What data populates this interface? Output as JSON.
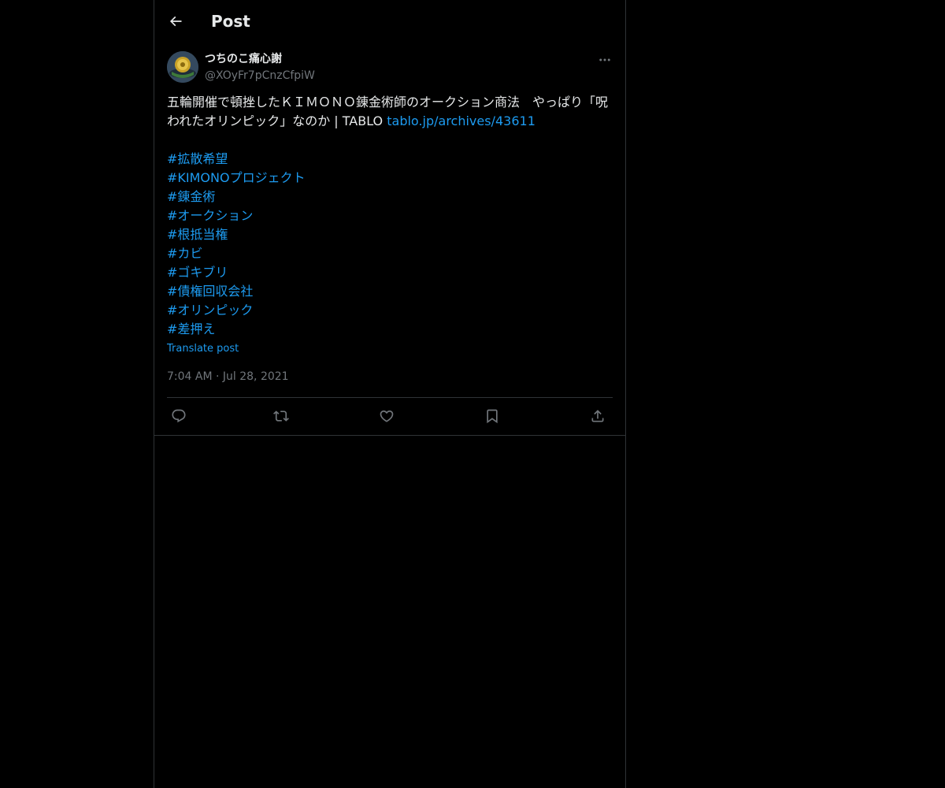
{
  "header": {
    "title": "Post",
    "back_icon": "arrow-left-icon"
  },
  "post": {
    "author": {
      "display_name": "つちのこ痛心謝",
      "handle": "@XOyFr7pCnzCfpiW",
      "avatar_icon": "police-emblem-avatar"
    },
    "more_icon": "more-horizontal-icon",
    "text_line": "五輪開催で頓挫したＫＩＭＯＮＯ錬金術師のオークション商法　やっぱり「呪われたオリンピック」なのか | TABLO ",
    "link_text": "tablo.jp/archives/43611",
    "hashtags": [
      "#拡散希望",
      "#KIMONOプロジェクト",
      "#錬金術",
      "#オークション",
      "#根抵当権",
      "#カビ",
      "#ゴキブリ",
      "#債権回収会社",
      "#オリンピック",
      "#差押え"
    ],
    "translate_label": "Translate post",
    "timestamp": "7:04 AM · Jul 28, 2021"
  },
  "actions": {
    "reply_icon": "reply-icon",
    "repost_icon": "repost-icon",
    "like_icon": "heart-icon",
    "bookmark_icon": "bookmark-icon",
    "share_icon": "share-icon"
  },
  "colors": {
    "background": "#000000",
    "text": "#e7e9ea",
    "muted": "#71767b",
    "link": "#1d9bf0",
    "border": "#2f3336"
  }
}
